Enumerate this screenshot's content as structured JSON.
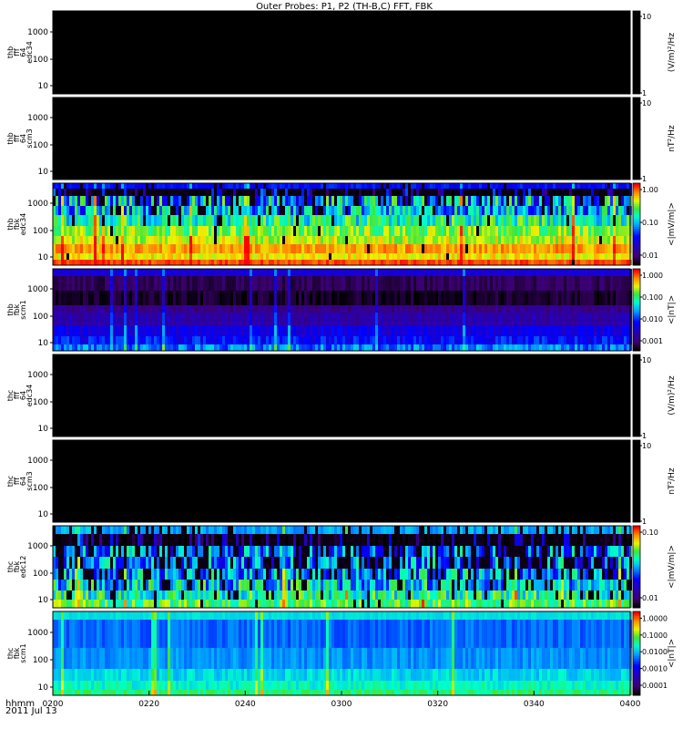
{
  "chart_data": {
    "type": "heatmap",
    "title": "Outer Probes: P1, P2 (TH-B,C) FFT, FBK",
    "x_axis": {
      "ticks": [
        "0200",
        "0220",
        "0240",
        "0300",
        "0320",
        "0340",
        "0400"
      ],
      "corner_label_1": "hhmm",
      "corner_label_2": "2011 Jul 13"
    },
    "y_scale": "log",
    "panels": [
      {
        "id": "thb-fff-edc34",
        "ylabel": [
          "thb",
          "fff",
          "64",
          "edc34"
        ],
        "yticks": [
          "10",
          "100",
          "1000"
        ],
        "cbar_label": "(V/m)²/Hz",
        "cbar_ticks": [
          "1",
          "10"
        ],
        "cbar_type": "black",
        "pattern": "empty"
      },
      {
        "id": "thb-fff-scm3",
        "ylabel": [
          "thb",
          "fff",
          "64",
          "scm3"
        ],
        "yticks": [
          "10",
          "100",
          "1000"
        ],
        "cbar_label": "nT²/Hz",
        "cbar_ticks": [
          "1",
          "10"
        ],
        "cbar_type": "black",
        "pattern": "empty"
      },
      {
        "id": "thb-fbk-edc34",
        "ylabel": [
          "thb",
          "fbk",
          "edc34"
        ],
        "yticks": [
          "10",
          "100",
          "1000"
        ],
        "cbar_label": "<|mV/m|>",
        "cbar_ticks": [
          "0.01",
          "0.10",
          "1.00"
        ],
        "cbar_type": "rainbow",
        "pattern": "e_hot"
      },
      {
        "id": "thb-fbk-scm1",
        "ylabel": [
          "thb",
          "fbk",
          "scm1"
        ],
        "yticks": [
          "10",
          "100",
          "1000"
        ],
        "cbar_label": "<|nT|>",
        "cbar_ticks": [
          "0.001",
          "0.010",
          "0.100",
          "1.000"
        ],
        "cbar_type": "rainbow",
        "pattern": "scm_dark"
      },
      {
        "id": "thc-fff-edc34",
        "ylabel": [
          "thc",
          "fff",
          "64",
          "edc34"
        ],
        "yticks": [
          "10",
          "100",
          "1000"
        ],
        "cbar_label": "(V/m)²/Hz",
        "cbar_ticks": [
          "1",
          "10"
        ],
        "cbar_type": "black",
        "pattern": "empty"
      },
      {
        "id": "thc-fff-scm3",
        "ylabel": [
          "thc",
          "fff",
          "64",
          "scm3"
        ],
        "yticks": [
          "10",
          "100",
          "1000"
        ],
        "cbar_label": "nT²/Hz",
        "cbar_ticks": [
          "1",
          "10"
        ],
        "cbar_type": "black",
        "pattern": "empty"
      },
      {
        "id": "thc-fbk-edc12",
        "ylabel": [
          "thc",
          "fbk",
          "edc12"
        ],
        "yticks": [
          "10",
          "100",
          "1000"
        ],
        "cbar_label": "<|mV/m|>",
        "cbar_ticks": [
          "0.01",
          "0.10"
        ],
        "cbar_type": "rainbow",
        "pattern": "e_mid"
      },
      {
        "id": "thc-fbk-scm1",
        "ylabel": [
          "thc",
          "fbk",
          "scm1"
        ],
        "yticks": [
          "10",
          "100",
          "1000"
        ],
        "cbar_label": "<|nT|>",
        "cbar_ticks": [
          "0.0001",
          "0.0010",
          "0.0100",
          "0.1000",
          "1.0000"
        ],
        "cbar_type": "rainbow",
        "pattern": "scm_blue"
      }
    ]
  },
  "colors": {
    "background": "#ffffff",
    "empty_panel": "#000000",
    "text": "#000000"
  }
}
